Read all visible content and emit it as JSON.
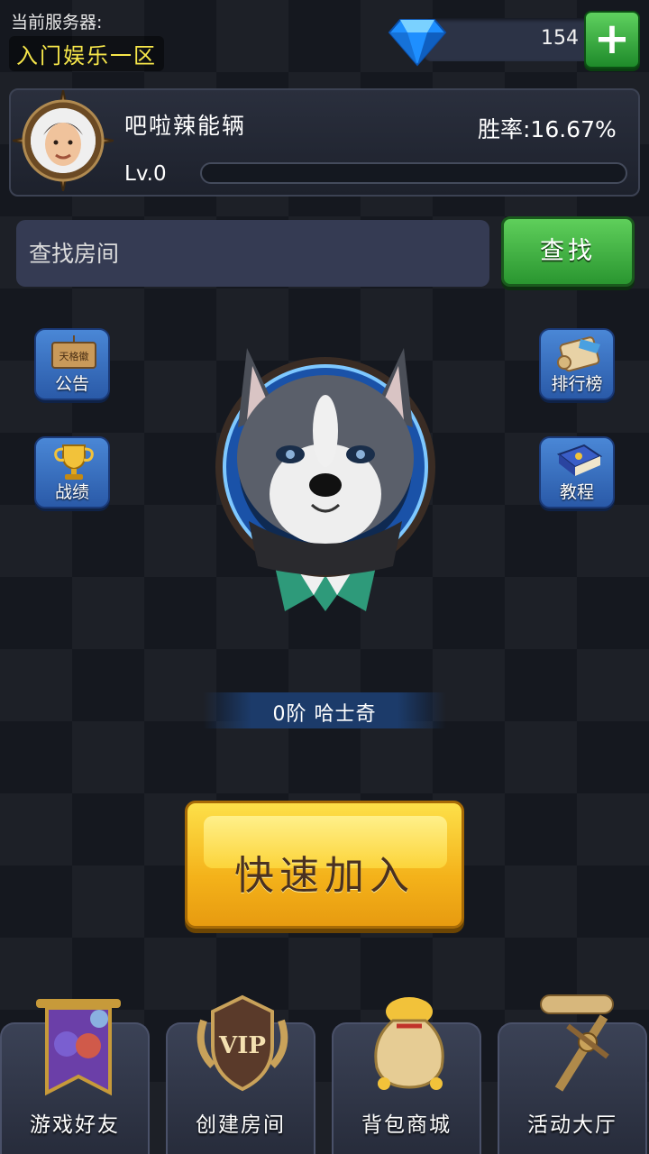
{
  "server": {
    "label": "当前服务器:",
    "name": "入门娱乐一区"
  },
  "currency": {
    "gems": "154",
    "add_icon": "plus-icon"
  },
  "profile": {
    "name": "吧啦辣能辆",
    "win_rate": "胜率:16.67%",
    "level": "Lv.0",
    "xp_progress": 0
  },
  "search": {
    "placeholder": "查找房间",
    "button": "查找"
  },
  "side_buttons": {
    "announcement": "公告",
    "record": "战绩",
    "leaderboard": "排行榜",
    "tutorial": "教程",
    "sign_text": "天格徽"
  },
  "rank": {
    "text": "0阶  哈士奇"
  },
  "quick_join": {
    "label": "快速加入"
  },
  "bottom_nav": [
    {
      "label": "游戏好友",
      "icon": "friends-banner-icon"
    },
    {
      "label": "创建房间",
      "icon": "vip-shield-icon"
    },
    {
      "label": "背包商城",
      "icon": "money-bag-icon"
    },
    {
      "label": "活动大厅",
      "icon": "scroll-sword-icon"
    }
  ],
  "colors": {
    "accent_green": "#2a9630",
    "accent_yellow": "#f4b21a",
    "server_name": "#f7e74a",
    "side_button_blue": "#3a70c0"
  }
}
